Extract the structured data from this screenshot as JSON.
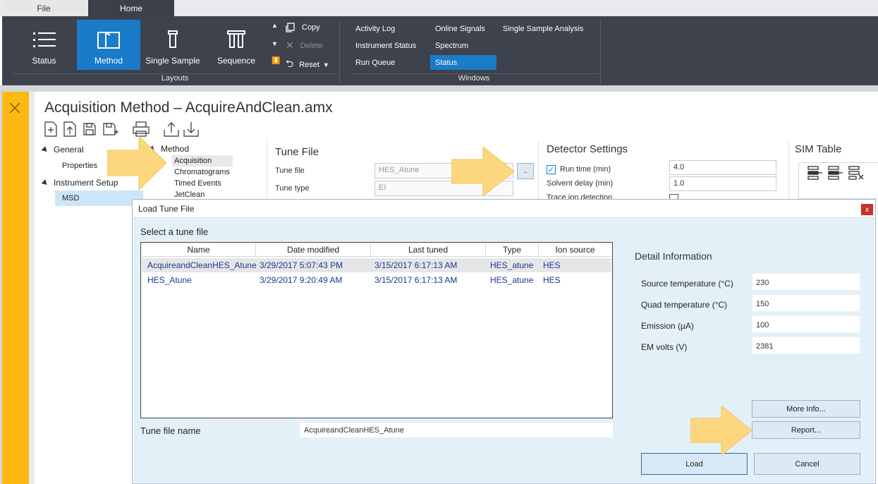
{
  "tabs": {
    "file": "File",
    "home": "Home"
  },
  "ribbon": {
    "layouts": {
      "status": "Status",
      "method": "Method",
      "single_sample": "Single Sample",
      "sequence": "Sequence",
      "group_label": "Layouts"
    },
    "edit": {
      "copy": "Copy",
      "delete": "Delete",
      "reset": "Reset"
    },
    "windows": {
      "activity_log": "Activity Log",
      "instrument_status": "Instrument Status",
      "run_queue": "Run Queue",
      "online_signals": "Online Signals",
      "spectrum": "Spectrum",
      "status": "Status",
      "single_sample_analysis": "Single Sample Analysis",
      "group_label": "Windows"
    }
  },
  "page": {
    "title": "Acquisition Method – AcquireAndClean.amx"
  },
  "nav": {
    "general": "General",
    "properties": "Properties",
    "instrument_setup": "Instrument Setup",
    "msd": "MSD"
  },
  "method_tree": {
    "method": "Method",
    "acquisition": "Acquisition",
    "chromatograms": "Chromatograms",
    "timed_events": "Timed Events",
    "jetclean": "JetClean"
  },
  "tune_file": {
    "heading": "Tune File",
    "tune_file_label": "Tune file",
    "tune_file_value": "HES_Atune",
    "browse": "..",
    "tune_type_label": "Tune type",
    "tune_type_value": "EI"
  },
  "detector": {
    "heading": "Detector Settings",
    "run_time_label": "Run time (min)",
    "run_time_value": "4.0",
    "solvent_delay_label": "Solvent delay (min)",
    "solvent_delay_value": "1.0",
    "trace_label": "Trace ion detection"
  },
  "sim": {
    "heading": "SIM Table"
  },
  "dialog": {
    "title": "Load Tune File",
    "close": "x",
    "prompt": "Select a tune file",
    "columns": [
      "Name",
      "Date modified",
      "Last tuned",
      "Type",
      "Ion source"
    ],
    "rows": [
      [
        "AcquireandCleanHES_Atune",
        "3/29/2017 5:07:43 PM",
        "3/15/2017 6:17:13 AM",
        "HES_atune",
        "HES"
      ],
      [
        "HES_Atune",
        "3/29/2017 9:20:49 AM",
        "3/15/2017 6:17:13 AM",
        "HES_atune",
        "HES"
      ]
    ],
    "tune_file_name_label": "Tune file name",
    "tune_file_name_value": "AcquireandCleanHES_Atune",
    "detail_heading": "Detail Information",
    "details": [
      {
        "label": "Source temperature (°C)",
        "value": "230"
      },
      {
        "label": "Quad temperature (°C)",
        "value": "150"
      },
      {
        "label": "Emission (µA)",
        "value": "100"
      },
      {
        "label": "EM volts (V)",
        "value": "2381"
      }
    ],
    "more_info": "More Info...",
    "report": "Report...",
    "load": "Load",
    "cancel": "Cancel"
  },
  "colors": {
    "accent": "#1a7bc9",
    "ribbon": "#3d424c",
    "sidebar": "#fdb813",
    "callout": "#fcd77f"
  }
}
